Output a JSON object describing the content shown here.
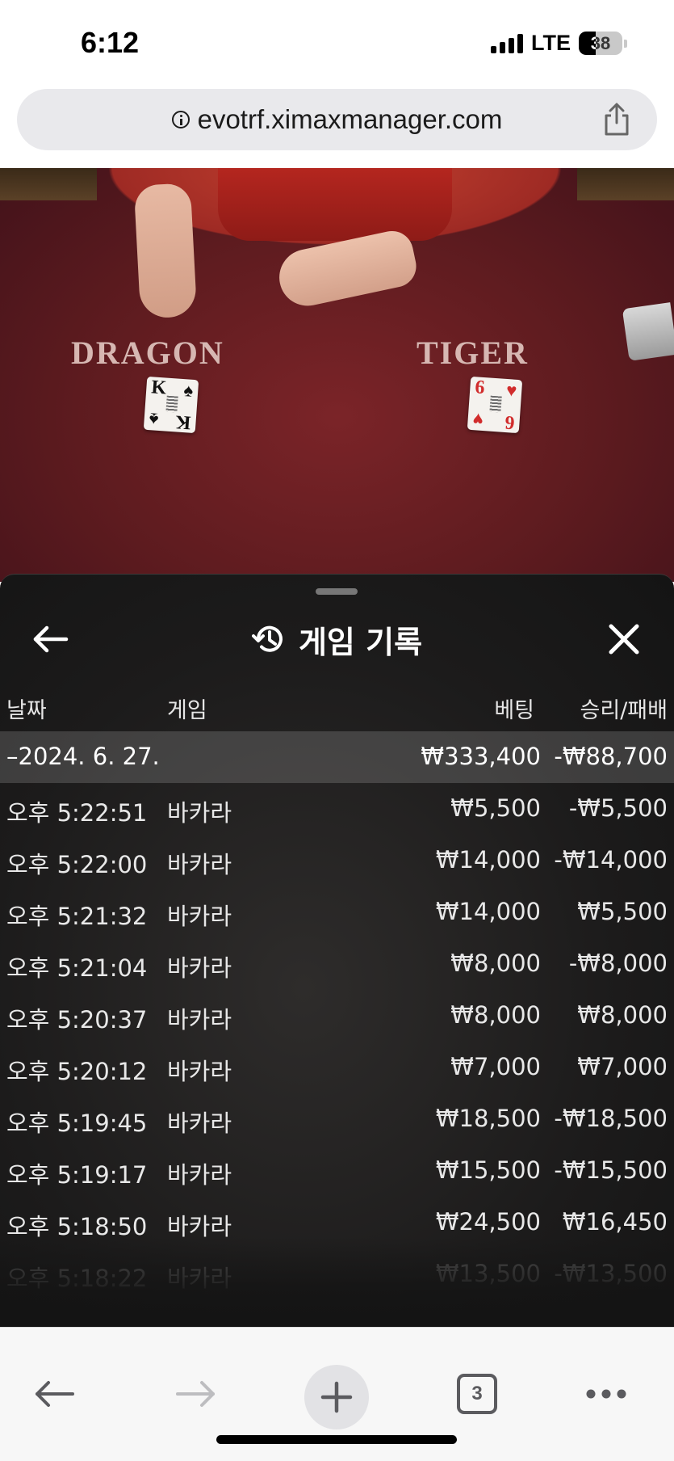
{
  "status_bar": {
    "time": "6:12",
    "network": "LTE",
    "battery": "38",
    "battery_level": 0.38
  },
  "browser": {
    "url": "evotrf.ximaxmanager.com",
    "tab_count": "3"
  },
  "game_view": {
    "left_label": "DRAGON",
    "right_label": "TIGER",
    "left_card": {
      "rank": "K",
      "suit": "♠",
      "color": "#111111"
    },
    "right_card": {
      "rank": "6",
      "suit": "♥",
      "color": "#d12c2c"
    }
  },
  "history": {
    "title": "게임 기록",
    "columns": {
      "date": "날짜",
      "game": "게임",
      "bet": "베팅",
      "result": "승리/패배"
    },
    "date_group": {
      "date": "–2024. 6. 27.",
      "bet": "₩333,400",
      "result": "-₩88,700"
    },
    "rows": [
      {
        "time": "오후 5:22:51",
        "game": "바카라",
        "bet": "₩5,500",
        "result": "-₩5,500"
      },
      {
        "time": "오후 5:22:00",
        "game": "바카라",
        "bet": "₩14,000",
        "result": "-₩14,000"
      },
      {
        "time": "오후 5:21:32",
        "game": "바카라",
        "bet": "₩14,000",
        "result": "₩5,500"
      },
      {
        "time": "오후 5:21:04",
        "game": "바카라",
        "bet": "₩8,000",
        "result": "-₩8,000"
      },
      {
        "time": "오후 5:20:37",
        "game": "바카라",
        "bet": "₩8,000",
        "result": "₩8,000"
      },
      {
        "time": "오후 5:20:12",
        "game": "바카라",
        "bet": "₩7,000",
        "result": "₩7,000"
      },
      {
        "time": "오후 5:19:45",
        "game": "바카라",
        "bet": "₩18,500",
        "result": "-₩18,500"
      },
      {
        "time": "오후 5:19:17",
        "game": "바카라",
        "bet": "₩15,500",
        "result": "-₩15,500"
      },
      {
        "time": "오후 5:18:50",
        "game": "바카라",
        "bet": "₩24,500",
        "result": "₩16,450"
      },
      {
        "time": "오후 5:18:22",
        "game": "바카라",
        "bet": "₩13,500",
        "result": "-₩13,500"
      }
    ]
  },
  "icons": {
    "back": "arrow-left-icon",
    "close": "close-icon",
    "history": "history-icon",
    "share": "share-icon",
    "info": "info-icon",
    "more": "more-icon",
    "new_tab": "plus-icon"
  }
}
